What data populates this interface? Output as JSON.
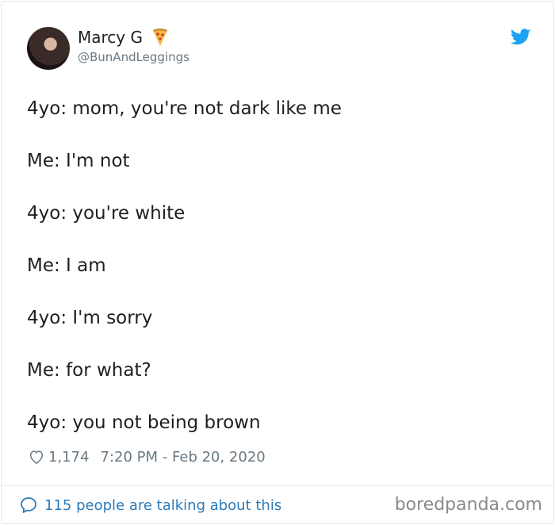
{
  "author": {
    "name": "Marcy G",
    "handle": "@BunAndLeggings",
    "emoji": "pizza-icon"
  },
  "tweet": {
    "lines": [
      "4yo: mom, you're not dark like me",
      "Me: I'm not",
      "4yo: you're white",
      "Me: I am",
      "4yo: I'm sorry",
      "Me: for what?",
      "4yo: you not being brown"
    ]
  },
  "meta": {
    "likes": "1,174",
    "timestamp": "7:20 PM - Feb 20, 2020"
  },
  "footer": {
    "talking": "115 people are talking about this",
    "watermark": "boredpanda.com"
  },
  "colors": {
    "twitter_blue": "#1da1f2",
    "link_blue": "#2b7bb9",
    "text": "#1c2022",
    "muted": "#697882",
    "border": "#e1e8ed"
  }
}
